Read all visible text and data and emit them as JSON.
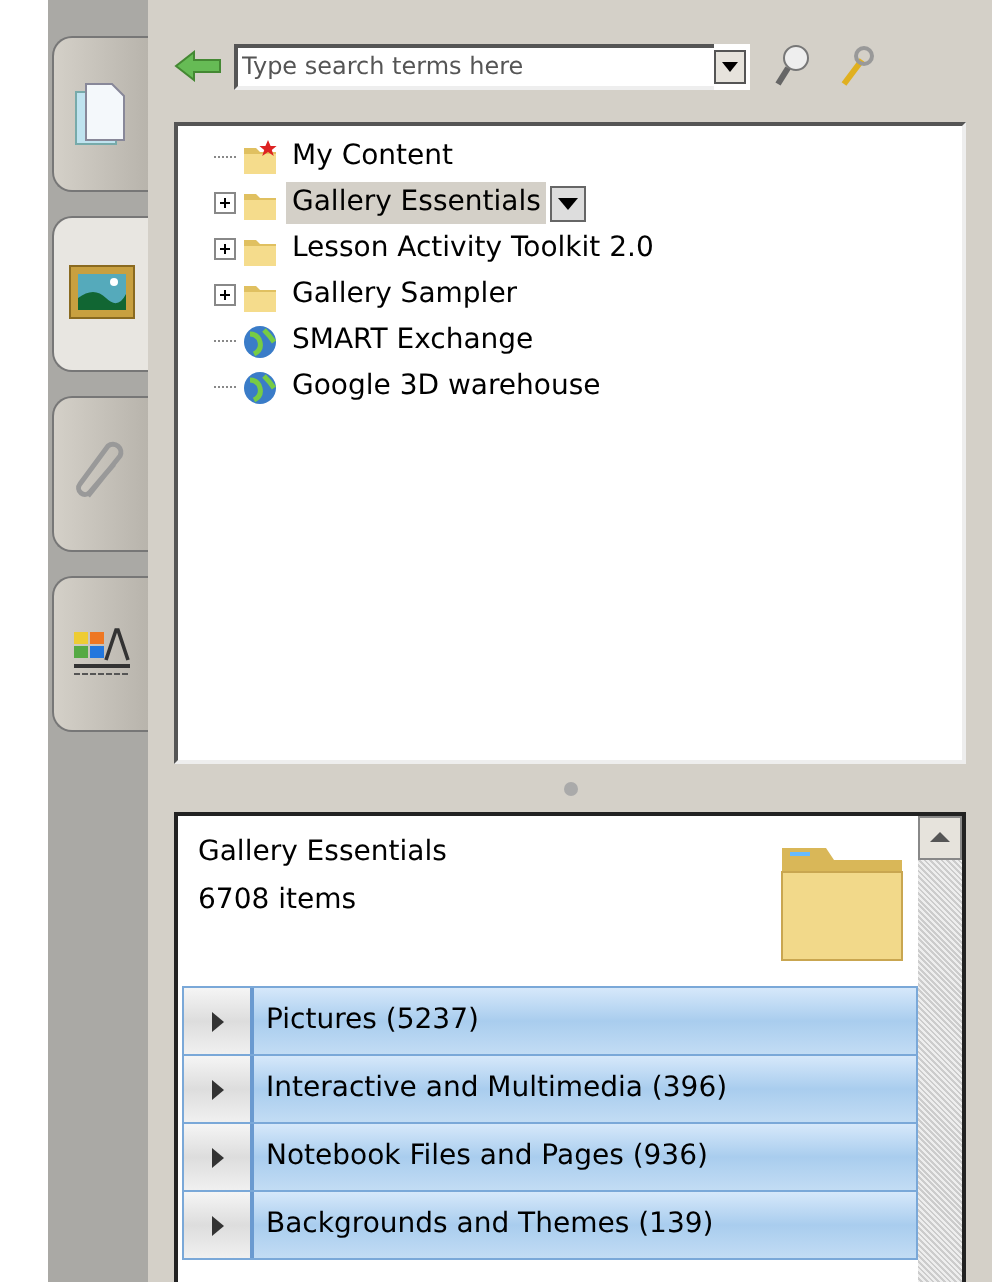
{
  "side_tabs": [
    {
      "kind": "page",
      "selected": false
    },
    {
      "kind": "gallery",
      "selected": true
    },
    {
      "kind": "attachment",
      "selected": false
    },
    {
      "kind": "properties",
      "selected": false
    }
  ],
  "search": {
    "placeholder": "Type search terms here"
  },
  "tree": [
    {
      "label": "My Content",
      "kind": "folder-star",
      "expandable": false,
      "selected": false
    },
    {
      "label": "Gallery Essentials",
      "kind": "folder",
      "expandable": true,
      "selected": true
    },
    {
      "label": "Lesson Activity Toolkit 2.0",
      "kind": "folder",
      "expandable": true,
      "selected": false
    },
    {
      "label": "Gallery Sampler",
      "kind": "folder",
      "expandable": true,
      "selected": false
    },
    {
      "label": "SMART Exchange",
      "kind": "globe",
      "expandable": false,
      "selected": false
    },
    {
      "label": "Google 3D warehouse",
      "kind": "globe",
      "expandable": false,
      "selected": false
    }
  ],
  "details": {
    "title": "Gallery Essentials",
    "count": "6708 items"
  },
  "categories": [
    {
      "label": "Pictures (5237)",
      "expanded": false
    },
    {
      "label": "Interactive and Multimedia (396)",
      "expanded": false
    },
    {
      "label": "Notebook Files and Pages (936)",
      "expanded": false
    },
    {
      "label": "Backgrounds and Themes (139)",
      "expanded": false
    }
  ]
}
